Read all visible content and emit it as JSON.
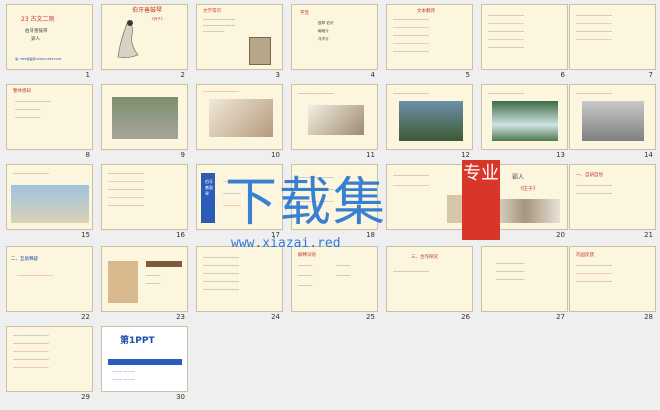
{
  "slides": [
    {
      "n": "1",
      "title": "23 古文二则",
      "sub1": "伯牙善鼓琴",
      "sub2": "郢人",
      "footer": "第一PPT模板网-WWW.1PPT.COM"
    },
    {
      "n": "2",
      "title": "伯牙善鼓琴",
      "sub": "《列子》"
    },
    {
      "n": "3",
      "title": "文学常识"
    },
    {
      "n": "4",
      "title": "字音",
      "w1": "鼓琴 伯牙",
      "w2": "峨峨兮",
      "w3": "洋洋兮"
    },
    {
      "n": "5",
      "title": "文本翻译"
    },
    {
      "n": "6"
    },
    {
      "n": "7"
    },
    {
      "n": "8",
      "title": "整体感知"
    },
    {
      "n": "9"
    },
    {
      "n": "10"
    },
    {
      "n": "11"
    },
    {
      "n": "12"
    },
    {
      "n": "13"
    },
    {
      "n": "14"
    },
    {
      "n": "15"
    },
    {
      "n": "16"
    },
    {
      "n": "17",
      "title": "伯牙善鼓琴"
    },
    {
      "n": "18"
    },
    {
      "n": "19"
    },
    {
      "n": "20",
      "title": "郢人",
      "sub": "《庄子》"
    },
    {
      "n": "21",
      "title": "一、自研自悟"
    },
    {
      "n": "22",
      "title": "二、互助释疑"
    },
    {
      "n": "23"
    },
    {
      "n": "24"
    },
    {
      "n": "25",
      "title": "解释词语"
    },
    {
      "n": "26",
      "title": "三、合作探究"
    },
    {
      "n": "27"
    },
    {
      "n": "28",
      "title": "巩固反馈"
    },
    {
      "n": "29"
    },
    {
      "n": "30",
      "title": "第1PPT"
    }
  ],
  "watermark": {
    "main": "下载集",
    "badge": "专业",
    "url": "www.xiazai.red"
  }
}
